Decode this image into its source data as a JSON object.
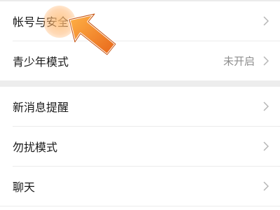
{
  "settings": {
    "group1": [
      {
        "label": "帐号与安全",
        "value": ""
      },
      {
        "label": "青少年模式",
        "value": "未开启"
      }
    ],
    "group2": [
      {
        "label": "新消息提醒",
        "value": ""
      },
      {
        "label": "勿扰模式",
        "value": ""
      },
      {
        "label": "聊天",
        "value": ""
      }
    ]
  },
  "icons": {
    "chevron": "chevron-right-icon",
    "pointer": "hand-pointer-icon"
  },
  "colors": {
    "pointer_orange": "#f07a1a",
    "highlight": "#ffbe78",
    "secondary_text": "#8e8e8e"
  }
}
